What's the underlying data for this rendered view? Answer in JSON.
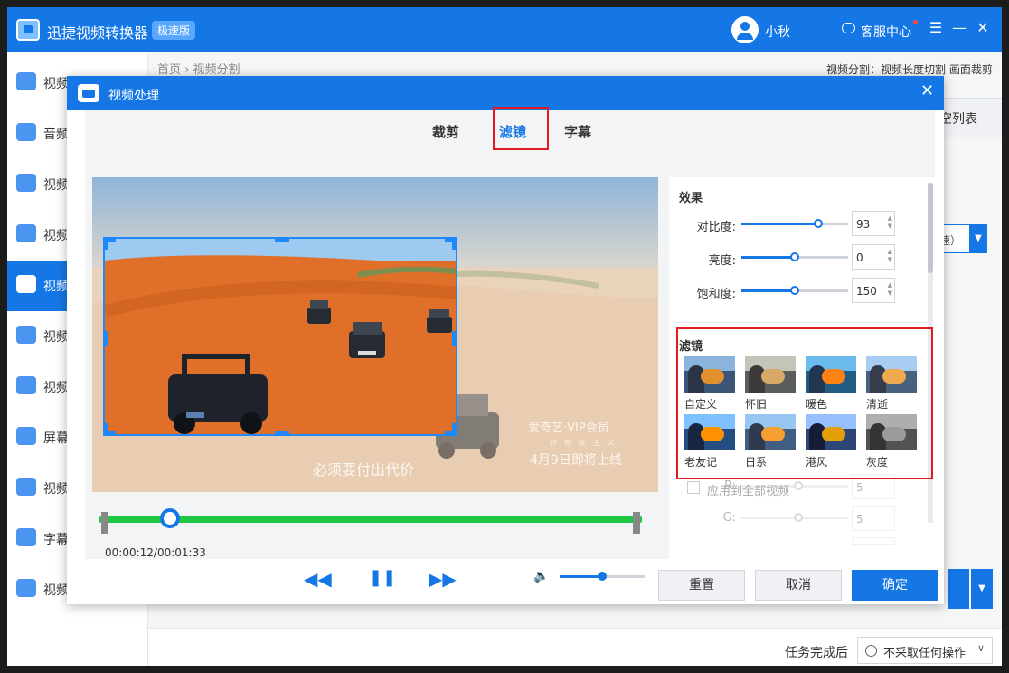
{
  "app": {
    "title": "迅捷视频转换器",
    "badge": "极速版",
    "user": "小秋",
    "support": "客服中心"
  },
  "sidebar": {
    "items": [
      {
        "label": "视频转换",
        "icon": "video-convert-icon"
      },
      {
        "label": "音频",
        "icon": "audio-icon"
      },
      {
        "label": "视频",
        "icon": "video-compress-icon"
      },
      {
        "label": "视频",
        "icon": "video-merge-icon"
      },
      {
        "label": "视频",
        "icon": "video-split-icon",
        "active": true
      },
      {
        "label": "视频",
        "icon": "video-watermark-icon"
      },
      {
        "label": "视频",
        "icon": "video-gif-icon"
      },
      {
        "label": "屏幕",
        "icon": "screen-record-icon"
      },
      {
        "label": "视频",
        "icon": "video-edit-icon"
      },
      {
        "label": "字幕",
        "icon": "subtitle-icon"
      },
      {
        "label": "视频",
        "icon": "video-enhance-icon"
      }
    ]
  },
  "main": {
    "breadcrumb": "首页 › 视频分割",
    "mode": "视频分割：视频长度切割 画面裁剪",
    "clear_list": "空列表",
    "speed_label": "速）",
    "after_task_label": "任务完成后",
    "after_task_value": "不采取任何操作"
  },
  "dialog": {
    "title": "视频处理",
    "tabs": [
      "裁剪",
      "滤镜",
      "字幕"
    ],
    "active_tab": "滤镜",
    "video": {
      "watermark_brand": "爱奇艺·VIP会员",
      "watermark_line2": "好　奇　就　主　义",
      "watermark_date": "4月9日即将上线",
      "subtitle": "必须要付出代价"
    },
    "timecode": "00:00:12/00:01:33",
    "progress_ratio": 0.13,
    "volume_ratio": 0.5,
    "effects": {
      "title": "效果",
      "rows": [
        {
          "label": "对比度:",
          "value": "93",
          "ratio": 0.72
        },
        {
          "label": "亮度:",
          "value": "0",
          "ratio": 0.5
        },
        {
          "label": "饱和度:",
          "value": "150",
          "ratio": 0.5
        }
      ]
    },
    "filters": {
      "title": "滤镜",
      "items": [
        "自定义",
        "怀旧",
        "暖色",
        "清逝",
        "老友记",
        "日系",
        "港风",
        "灰度"
      ]
    },
    "rgb_rows": [
      {
        "label": "R:",
        "value": "5"
      },
      {
        "label": "G:",
        "value": "5"
      }
    ],
    "apply_all": "应用到全部视频",
    "buttons": {
      "reset": "重置",
      "cancel": "取消",
      "ok": "确定"
    }
  },
  "colors": {
    "accent": "#1577e6",
    "progress": "#1fc745",
    "highlight": "#e5191f"
  }
}
